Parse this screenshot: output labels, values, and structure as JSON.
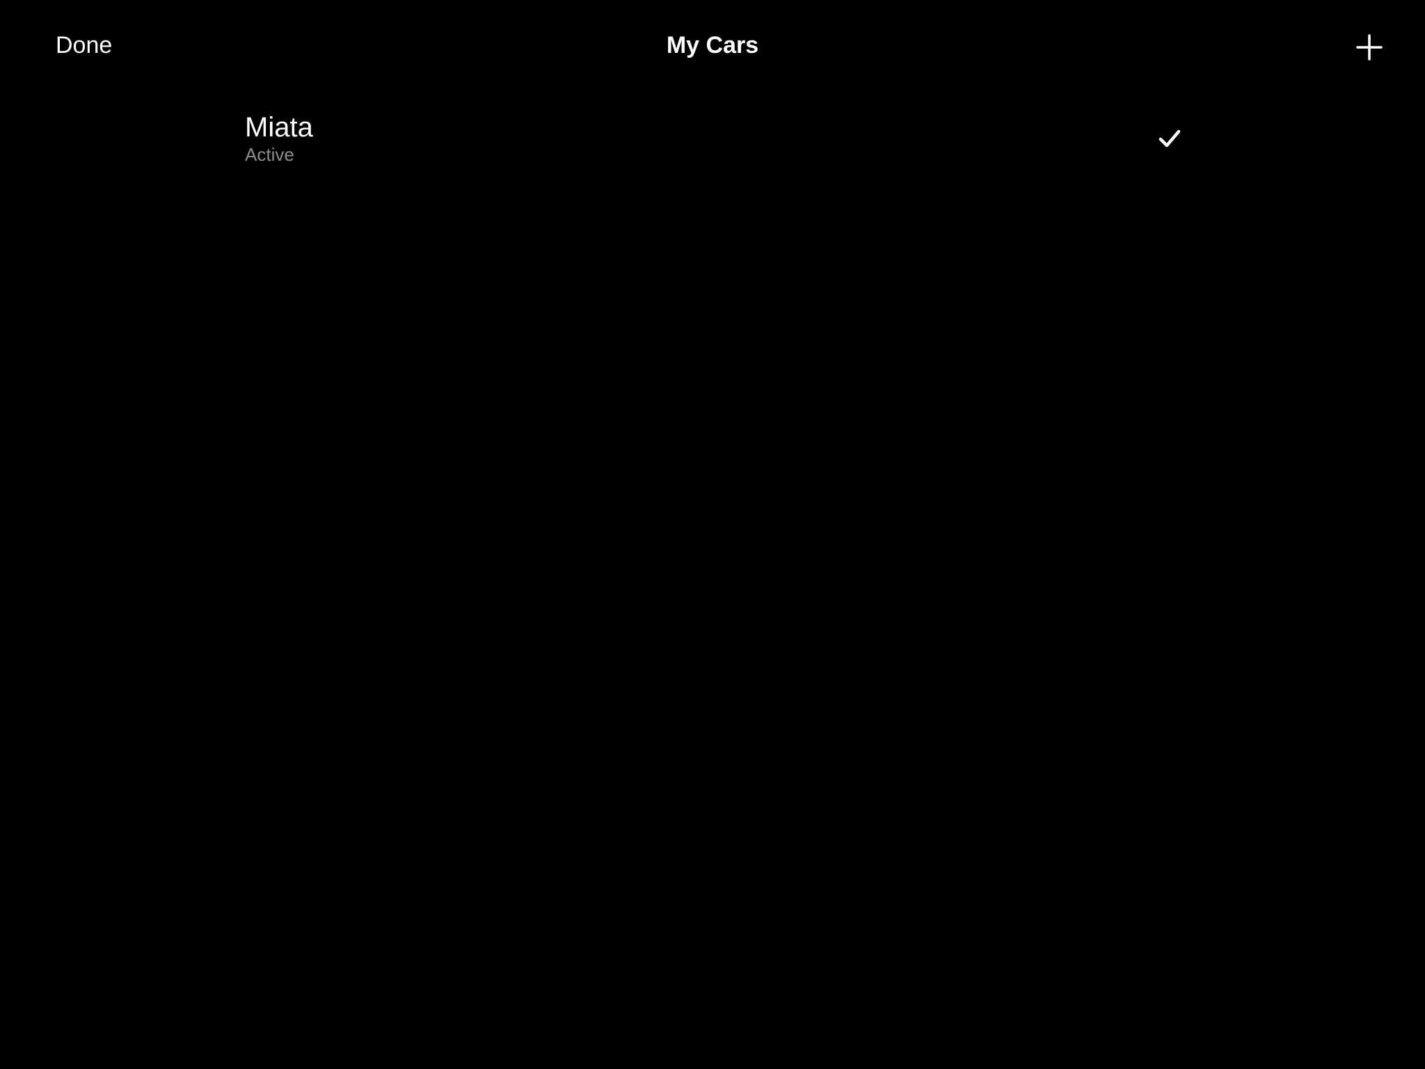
{
  "nav": {
    "done_label": "Done",
    "title": "My Cars",
    "add_icon": "plus-icon"
  },
  "cars": [
    {
      "name": "Miata",
      "status": "Active",
      "selected": true,
      "selected_icon": "checkmark-icon"
    }
  ],
  "colors": {
    "background": "#000000",
    "text": "#ffffff",
    "secondary_text": "#8e8e8e"
  }
}
